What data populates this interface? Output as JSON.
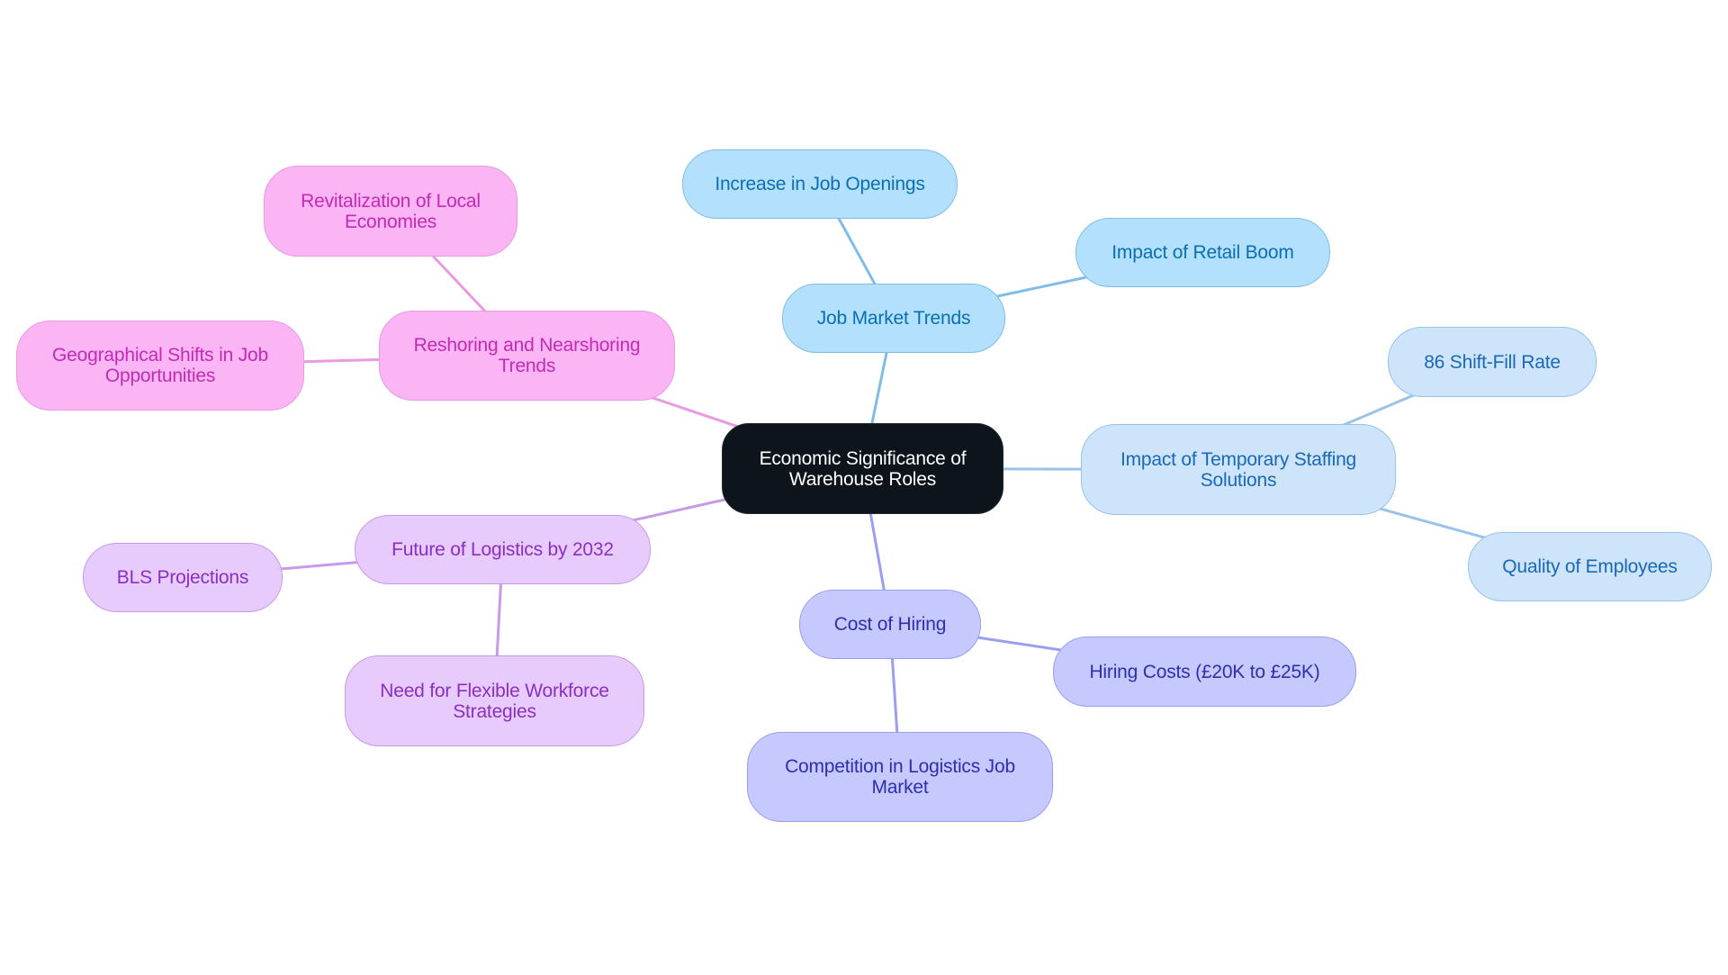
{
  "title": "Economic Significance of Warehouse Roles",
  "mindmap": {
    "root": {
      "id": "root",
      "label": "Economic Significance of Warehouse Roles"
    },
    "branches": [
      {
        "id": "job-market-trends",
        "label": "Job Market Trends",
        "color": {
          "fill": "#b3e0fd",
          "stroke": "#7fbde8",
          "text": "#0a6fb5"
        },
        "children": [
          {
            "id": "increase-in-job-openings",
            "label": "Increase in Job Openings"
          },
          {
            "id": "impact-of-retail-boom",
            "label": "Impact of Retail Boom"
          }
        ]
      },
      {
        "id": "impact-of-temporary-staffing",
        "label": "Impact of Temporary Staffing Solutions",
        "color": {
          "fill": "#cde4fa",
          "stroke": "#99c3ea",
          "text": "#1a68b8"
        },
        "children": [
          {
            "id": "shift-fill-rate",
            "label": "86 Shift-Fill Rate"
          },
          {
            "id": "quality-of-employees",
            "label": "Quality of Employees"
          }
        ]
      },
      {
        "id": "cost-of-hiring",
        "label": "Cost of Hiring",
        "color": {
          "fill": "#c6c9fd",
          "stroke": "#9a9ef0",
          "text": "#2e2fb0"
        },
        "children": [
          {
            "id": "hiring-costs",
            "label": "Hiring Costs (£20K to £25K)"
          },
          {
            "id": "competition-logistics",
            "label": "Competition in Logistics Job Market"
          }
        ]
      },
      {
        "id": "future-of-logistics",
        "label": "Future of Logistics by 2032",
        "color": {
          "fill": "#e8cbfd",
          "stroke": "#c79ae8",
          "text": "#8a2fc4"
        },
        "children": [
          {
            "id": "bls-projections",
            "label": "BLS Projections"
          },
          {
            "id": "flexible-workforce",
            "label": "Need for Flexible Workforce Strategies"
          }
        ]
      },
      {
        "id": "reshoring-trends",
        "label": "Reshoring and Nearshoring Trends",
        "color": {
          "fill": "#fbb4f4",
          "stroke": "#e89be0",
          "text": "#c42bb5"
        },
        "children": [
          {
            "id": "revitalization",
            "label": "Revitalization of Local Economies"
          },
          {
            "id": "geographical-shifts",
            "label": "Geographical Shifts in Job Opportunities"
          }
        ]
      }
    ]
  }
}
